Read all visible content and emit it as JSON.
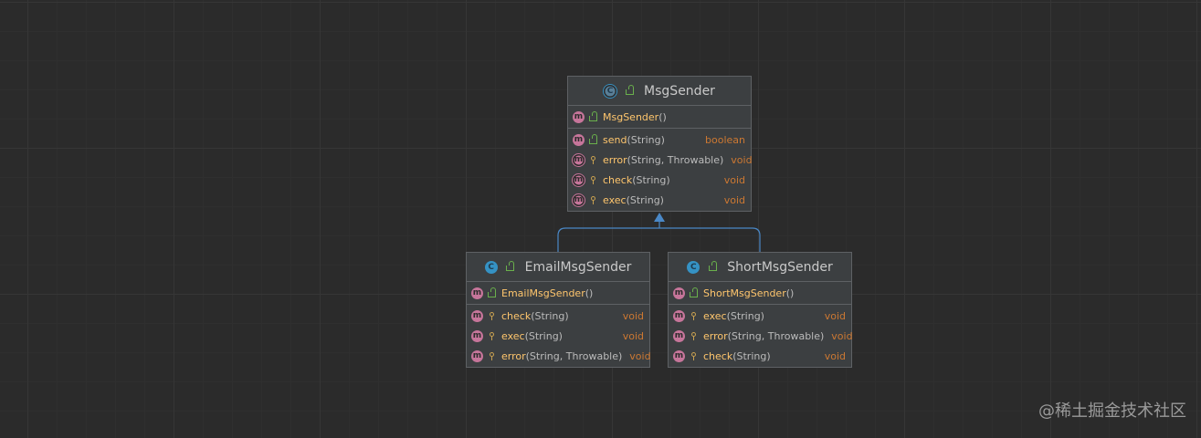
{
  "diagram": {
    "classes": [
      {
        "id": "msgsender",
        "name": "MsgSender",
        "kind": "abstract-class",
        "icon": "abstract-class-icon",
        "constructors": [
          {
            "name": "MsgSender",
            "params": "()",
            "visibility": "public",
            "abstract": false,
            "type": ""
          }
        ],
        "methods": [
          {
            "name": "send",
            "params": "(String)",
            "visibility": "public",
            "abstract": false,
            "type": "boolean"
          },
          {
            "name": "error",
            "params": "(String, Throwable)",
            "visibility": "protected",
            "abstract": true,
            "type": "void"
          },
          {
            "name": "check",
            "params": "(String)",
            "visibility": "protected",
            "abstract": true,
            "type": "void"
          },
          {
            "name": "exec",
            "params": "(String)",
            "visibility": "protected",
            "abstract": true,
            "type": "void"
          }
        ]
      },
      {
        "id": "emailmsgsender",
        "name": "EmailMsgSender",
        "kind": "class",
        "icon": "class-icon",
        "constructors": [
          {
            "name": "EmailMsgSender",
            "params": "()",
            "visibility": "public",
            "abstract": false,
            "type": ""
          }
        ],
        "methods": [
          {
            "name": "check",
            "params": "(String)",
            "visibility": "protected",
            "abstract": false,
            "type": "void"
          },
          {
            "name": "exec",
            "params": "(String)",
            "visibility": "protected",
            "abstract": false,
            "type": "void"
          },
          {
            "name": "error",
            "params": "(String, Throwable)",
            "visibility": "protected",
            "abstract": false,
            "type": "void"
          }
        ]
      },
      {
        "id": "shortmsgsender",
        "name": "ShortMsgSender",
        "kind": "class",
        "icon": "class-icon",
        "constructors": [
          {
            "name": "ShortMsgSender",
            "params": "()",
            "visibility": "public",
            "abstract": false,
            "type": ""
          }
        ],
        "methods": [
          {
            "name": "exec",
            "params": "(String)",
            "visibility": "protected",
            "abstract": false,
            "type": "void"
          },
          {
            "name": "error",
            "params": "(String, Throwable)",
            "visibility": "protected",
            "abstract": false,
            "type": "void"
          },
          {
            "name": "check",
            "params": "(String)",
            "visibility": "protected",
            "abstract": false,
            "type": "void"
          }
        ]
      }
    ],
    "relations": [
      {
        "from": "emailmsgsender",
        "to": "msgsender",
        "type": "extends"
      },
      {
        "from": "shortmsgsender",
        "to": "msgsender",
        "type": "extends"
      }
    ]
  },
  "watermark": "@稀土掘金技术社区",
  "colors": {
    "background": "#2b2b2b",
    "node_background": "#3c3f41",
    "node_border": "#5e6164",
    "method_name": "#ffc66d",
    "return_type": "#cc7832",
    "inheritance_arrow": "#4a88c7",
    "method_icon": "#c6759a",
    "class_icon": "#3592c4"
  }
}
